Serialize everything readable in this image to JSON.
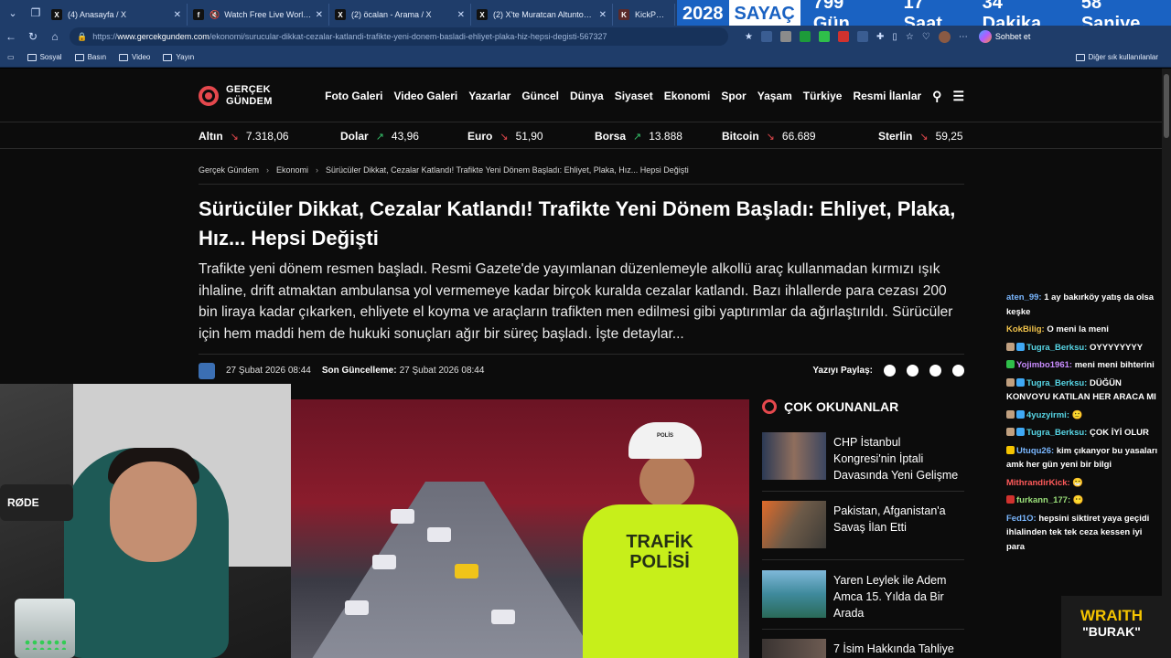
{
  "browser": {
    "tabs": [
      {
        "favicon": "X",
        "title": "(4) Anasayfa / X"
      },
      {
        "favicon": "f",
        "title": "Watch Free Live World TV | G"
      },
      {
        "favicon": "X",
        "title": "(2) öcalan - Arama / X"
      },
      {
        "favicon": "X",
        "title": "(2) X'te Muratcan Altuntoprak: \"A"
      },
      {
        "favicon": "K",
        "title": "KickPeek - Re"
      }
    ],
    "url_prefix": "https://",
    "url_domain": "www.gercekgundem.com",
    "url_path": "/ekonomi/surucular-dikkat-cezalar-katlandi-trafikte-yeni-donem-basladi-ehliyet-plaka-hiz-hepsi-degisti-567327",
    "chat_button": "Sohbet et",
    "bookmarks": [
      "Sosyal",
      "Basın",
      "Video",
      "Yayın"
    ],
    "bookmarks_other": "Diğer sık kullanılanlar"
  },
  "counter": {
    "year": "2028",
    "label": "SAYAÇ",
    "days": "799 Gün",
    "hours": "17 Saat",
    "minutes": "34 Dakika",
    "seconds": "58 Saniye"
  },
  "site": {
    "logo_line1": "GERÇEK",
    "logo_line2": "GÜNDEM",
    "nav": [
      "Foto Galeri",
      "Video Galeri",
      "Yazarlar",
      "Güncel",
      "Dünya",
      "Siyaset",
      "Ekonomi",
      "Spor",
      "Yaşam",
      "Türkiye",
      "Resmi İlanlar"
    ]
  },
  "ticker": [
    {
      "name": "Altın",
      "dir": "down",
      "value": "7.318,06"
    },
    {
      "name": "Dolar",
      "dir": "up",
      "value": "43,96"
    },
    {
      "name": "Euro",
      "dir": "down",
      "value": "51,90"
    },
    {
      "name": "Borsa",
      "dir": "up",
      "value": "13.888"
    },
    {
      "name": "Bitcoin",
      "dir": "down",
      "value": "66.689"
    },
    {
      "name": "Sterlin",
      "dir": "down",
      "value": "59,25"
    }
  ],
  "breadcrumb": [
    "Gerçek Gündem",
    "Ekonomi",
    "Sürücüler Dikkat, Cezalar Katlandı! Trafikte Yeni Dönem Başladı: Ehliyet, Plaka, Hız... Hepsi Değişti"
  ],
  "article": {
    "title": "Sürücüler Dikkat, Cezalar Katlandı! Trafikte Yeni Dönem Başladı: Ehliyet, Plaka, Hız... Hepsi Değişti",
    "lead": "Trafikte yeni dönem resmen başladı. Resmi Gazete'de yayımlanan düzenlemeyle alkollü araç kullanmadan kırmızı ışık ihlaline, drift atmaktan ambulansa yol vermemeye kadar birçok kuralda cezalar katlandı. Bazı ihlallerde para cezası 200 bin liraya kadar çıkarken, ehliyete el koyma ve araçların trafikten men edilmesi gibi yaptırımlar da ağırlaştırıldı. Sürücüler için hem maddi hem de hukuki sonuçları ağır bir süreç başladı. İşte detaylar...",
    "published": "27 Şubat 2026 08:44",
    "updated_label": "Son Güncelleme:",
    "updated": "27 Şubat 2026 08:44",
    "share_label": "Yazıyı Paylaş:",
    "hero_vest_text": "TRAFİK POLİSİ",
    "hero_cap_text": "POLİS"
  },
  "most_read": {
    "title": "ÇOK OKUNANLAR",
    "items": [
      "CHP İstanbul Kongresi'nin İptali Davasında Yeni Gelişme",
      "Pakistan, Afganistan'a Savaş İlan Etti",
      "Yaren Leylek ile Adem Amca 15. Yılda da Bir Arada",
      "7 İsim Hakkında Tahliye"
    ]
  },
  "chat": [
    {
      "user": "aten_99:",
      "color": "#7ab7ff",
      "text": "1 ay bakırköy yatış da olsa keşke"
    },
    {
      "user": "KokBilig:",
      "color": "#f0c24b",
      "text": "O meni la meni"
    },
    {
      "user": "Tugra_Berksu:",
      "color": "#57d6e6",
      "text": "OYYYYYYYY"
    },
    {
      "user": "Yojimbo1961:",
      "color": "#c98cff",
      "text": "meni meni bihterini"
    },
    {
      "user": "Tugra_Berksu:",
      "color": "#57d6e6",
      "text": "DÜĞÜN KONVOYU KATILAN HER ARACA MI"
    },
    {
      "user": "4yuzyirmi:",
      "color": "#57d6e6",
      "text": "🙂"
    },
    {
      "user": "Tugra_Berksu:",
      "color": "#57d6e6",
      "text": "ÇOK İYİ OLUR"
    },
    {
      "user": "Utuqu26:",
      "color": "#7ab7ff",
      "text": "kim çıkanyor bu yasaları amk her gün yeni bir bilgi"
    },
    {
      "user": "MithrandirKick:",
      "color": "#ff5a5a",
      "text": "😁"
    },
    {
      "user": "furkann_177:",
      "color": "#9be07a",
      "text": "😶"
    },
    {
      "user": "Fed1O:",
      "color": "#7ab7ff",
      "text": "hepsini siktiret yaya geçidi ihlalinden tek tek ceza kessen iyi para"
    }
  ],
  "webcam": {
    "mic_label": "RØDE"
  },
  "overlay_badge": {
    "line1": "WRAITH",
    "line2": "\"BURAK\""
  }
}
